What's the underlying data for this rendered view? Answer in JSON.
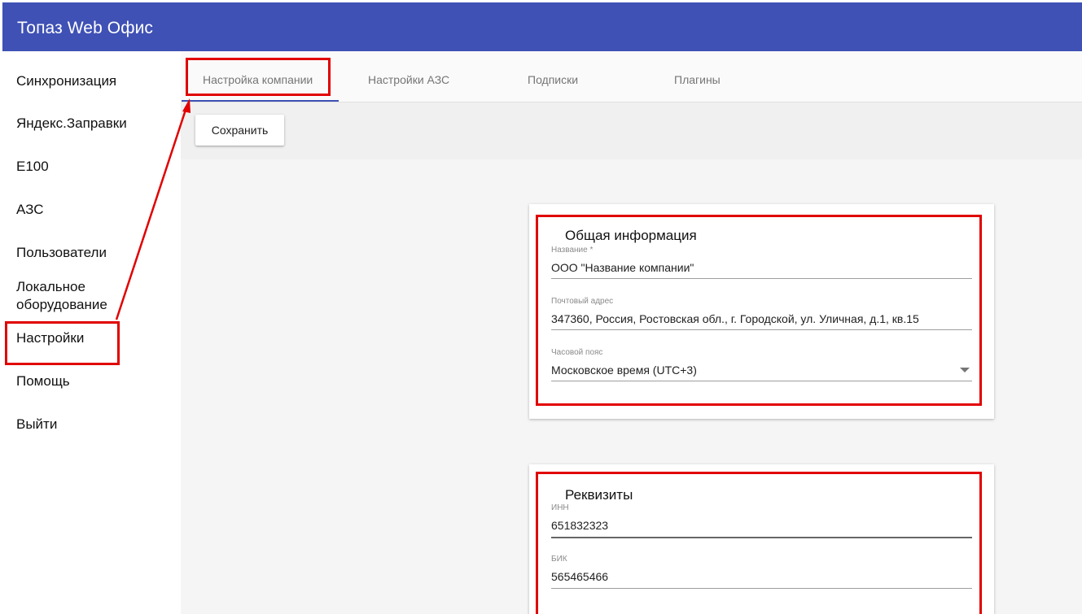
{
  "appbar": {
    "title": "Топаз Web Офис"
  },
  "sidebar": {
    "items": [
      {
        "label": "Синхронизация"
      },
      {
        "label": "Яндекс.Заправки"
      },
      {
        "label": "E100"
      },
      {
        "label": "АЗС"
      },
      {
        "label": "Пользователи"
      },
      {
        "label": "Локальное оборудование"
      },
      {
        "label": "Настройки"
      },
      {
        "label": "Помощь"
      },
      {
        "label": "Выйти"
      }
    ]
  },
  "tabs": [
    {
      "label": "Настройка компании"
    },
    {
      "label": "Настройки АЗС"
    },
    {
      "label": "Подписки"
    },
    {
      "label": "Плагины"
    }
  ],
  "toolbar": {
    "save_label": "Сохранить"
  },
  "general": {
    "title": "Общая информация",
    "name_label": "Название *",
    "name_value": "ООО \"Название компании\"",
    "address_label": "Почтовый адрес",
    "address_value": "347360, Россия, Ростовская обл., г. Городской, ул. Уличная, д.1, кв.15",
    "timezone_label": "Часовой пояс",
    "timezone_value": "Московское время (UTC+3)"
  },
  "requisites": {
    "title": "Реквизиты",
    "inn_label": "ИНН",
    "inn_value": "651832323",
    "bik_label": "БИК",
    "bik_value": "565465466"
  },
  "colors": {
    "appbar": "#3f51b5",
    "highlight": "#e10000"
  }
}
